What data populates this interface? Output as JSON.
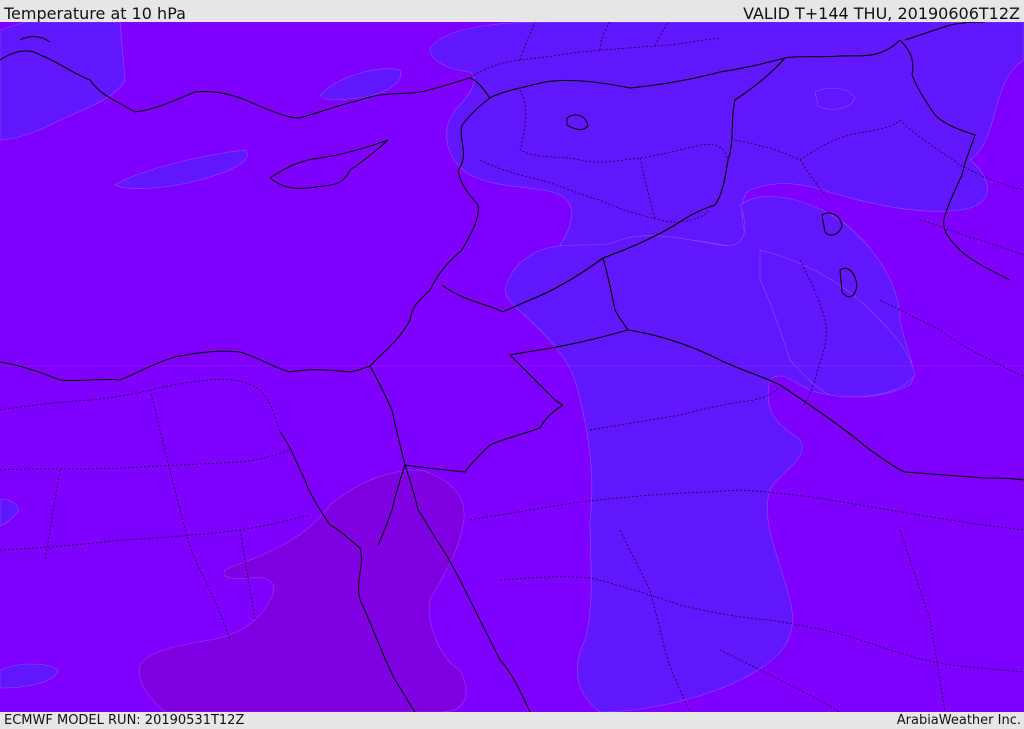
{
  "header": {
    "title": "Temperature at 10 hPa",
    "valid": "VALID T+144 THU, 20190606T12Z"
  },
  "footer": {
    "model_run": "ECMWF MODEL RUN: 20190531T12Z",
    "credit": "ArabiaWeather Inc."
  },
  "map": {
    "colors": {
      "base": "#7f00ff",
      "cool": "#6317ff",
      "warm": "#7f00e0",
      "border": "#000000"
    }
  }
}
